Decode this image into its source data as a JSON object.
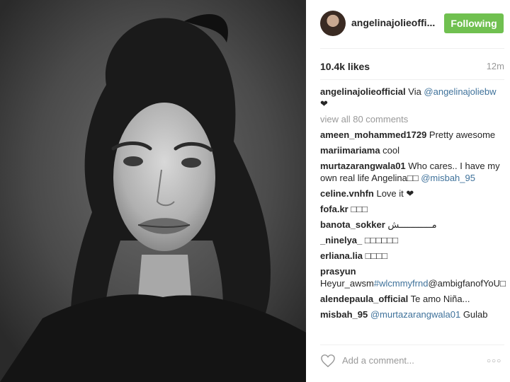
{
  "post": {
    "photo_alt": "Black and white portrait"
  },
  "header": {
    "username": "angelinajolieoffi...",
    "follow_label": "Following"
  },
  "stats": {
    "likes": "10.4k likes",
    "time": "12m"
  },
  "caption": {
    "user": "angelinajolieofficial",
    "text": " Via ",
    "link": "@angelinajoliebw",
    "suffix": " ❤"
  },
  "view_all": "view all 80 comments",
  "comments": [
    {
      "user": "ameen_mohammed1729",
      "text": " Pretty awesome",
      "link": "",
      "tail": ""
    },
    {
      "user": "mariimariama",
      "text": " cool",
      "link": "",
      "tail": ""
    },
    {
      "user": "murtazarangwala01",
      "text": " Who cares.. I have my own real life Angelina□□ ",
      "link": "@misbah_95",
      "tail": ""
    },
    {
      "user": "celine.vnhfn",
      "text": " Love it ❤",
      "link": "",
      "tail": ""
    },
    {
      "user": "fofa.kr",
      "text": " □□□",
      "link": "",
      "tail": ""
    },
    {
      "user": "banota_sokker",
      "text": " مــــــــــــش",
      "link": "",
      "tail": ""
    },
    {
      "user": "_ninelya_",
      "text": " □□□□□□",
      "link": "",
      "tail": ""
    },
    {
      "user": "erliana.lia",
      "text": " □□□□",
      "link": "",
      "tail": ""
    },
    {
      "user": "prasyun",
      "text": " Heyur_awsm",
      "link": "#wlcmmyfrnd",
      "tail": "@ambigfanofYoU□"
    },
    {
      "user": "alendepaula_official",
      "text": " Te amo Niña...",
      "link": "",
      "tail": ""
    },
    {
      "user": "misbah_95",
      "text": " ",
      "link": "@murtazarangwala01",
      "tail": " Gulab"
    }
  ],
  "footer": {
    "placeholder": "Add a comment...",
    "more": "○○○"
  },
  "colors": {
    "follow_bg": "#70c050",
    "link": "#3f729b",
    "muted": "#999999"
  }
}
